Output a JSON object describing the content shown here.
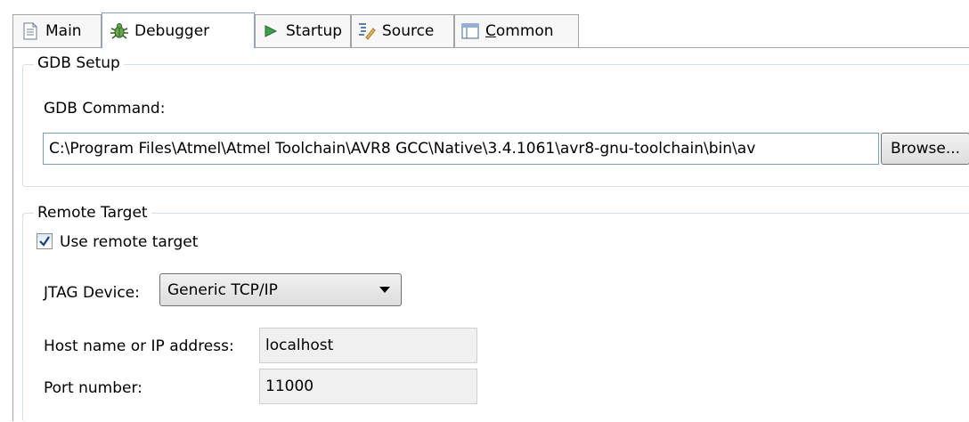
{
  "tabs": {
    "main": "Main",
    "debugger": "Debugger",
    "startup": "Startup",
    "source": "Source",
    "common_rest": "ommon",
    "common_mnemonic": "C"
  },
  "gdb_setup": {
    "legend": "GDB Setup",
    "command_label": "GDB Command:",
    "command_value": "C:\\Program Files\\Atmel\\Atmel Toolchain\\AVR8 GCC\\Native\\3.4.1061\\avr8-gnu-toolchain\\bin\\av",
    "browse_label": "Browse..."
  },
  "remote_target": {
    "legend": "Remote Target",
    "use_remote_label": "Use remote target",
    "use_remote_checked": true,
    "jtag_label": "JTAG Device:",
    "jtag_value": "Generic TCP/IP",
    "host_label": "Host name or IP address:",
    "host_value": "localhost",
    "port_label": "Port number:",
    "port_value": "11000"
  },
  "icons": {
    "main": "document-icon",
    "debugger": "bug-icon",
    "startup": "play-icon",
    "source": "source-lookup-icon",
    "common": "window-icon"
  }
}
